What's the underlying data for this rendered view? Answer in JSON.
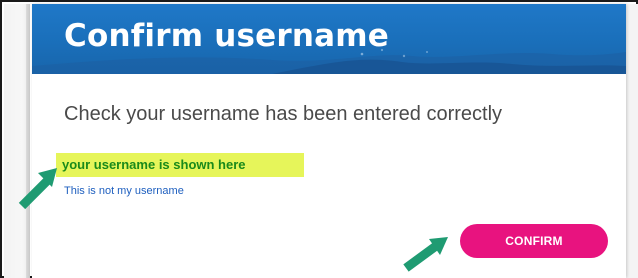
{
  "header": {
    "title": "Confirm username"
  },
  "main": {
    "instruction": "Check your username has been entered correctly",
    "username_display": "your username is shown here",
    "not_my_username_link": "This is not my username",
    "confirm_label": "CONFIRM"
  },
  "colors": {
    "banner": "#1a6fba",
    "highlight": "#e6f55a",
    "username_text": "#1a8a1a",
    "link": "#1e5fbf",
    "confirm_button": "#e8137f",
    "arrow": "#1f9b72"
  },
  "icons": [
    "arrow-pointer-icon"
  ]
}
